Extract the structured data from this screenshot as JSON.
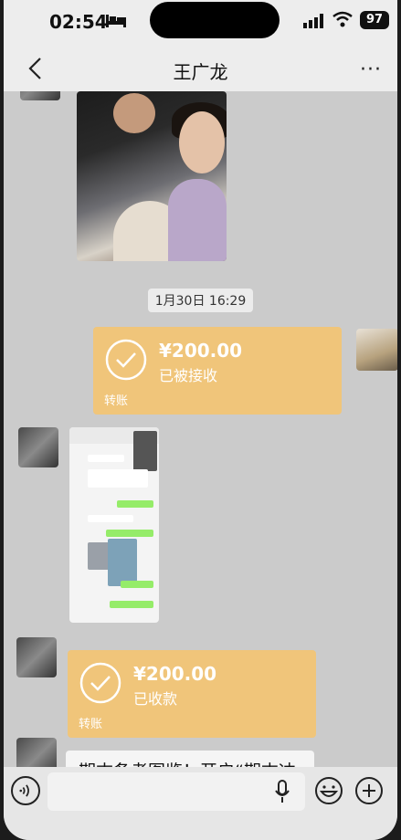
{
  "status_bar": {
    "time": "02:54",
    "battery": "97"
  },
  "nav": {
    "title": "王广龙"
  },
  "chat": {
    "timestamp": "1月30日 16:29",
    "transfer_sent": {
      "amount": "¥200.00",
      "status": "已被接收",
      "kind": "转账"
    },
    "transfer_received": {
      "amount": "¥200.00",
      "status": "已收款",
      "kind": "转账"
    },
    "partial_message": "期末备考图览！开启“期末冲"
  },
  "icons": {
    "status": [
      "bed-icon",
      "signal-icon",
      "wifi-icon"
    ],
    "nav": [
      "back-icon",
      "more-icon"
    ],
    "input": [
      "voice-icon",
      "mic-icon",
      "emoji-icon",
      "plus-icon"
    ]
  },
  "colors": {
    "transfer": "#f0c57a",
    "chat_bg": "#cbcbcb",
    "bar_bg": "#ededed"
  }
}
